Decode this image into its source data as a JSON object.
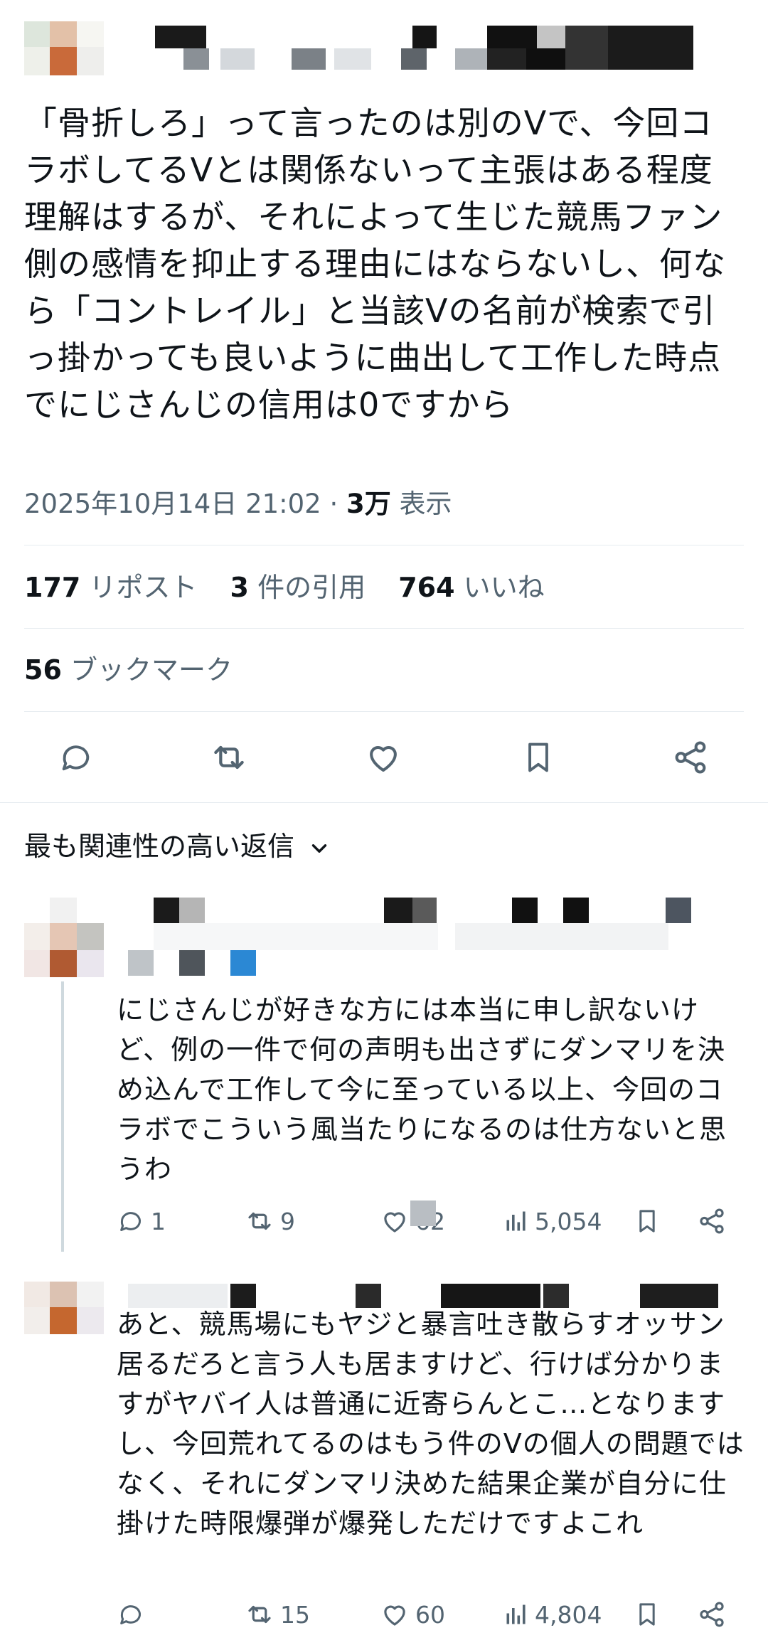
{
  "tweet": {
    "text": "「骨折しろ」って言ったのは別のVで、今回コラボしてるVとは関係ないって主張はある程度理解はするが、それによって生じた競馬ファン側の感情を抑止する理由にはならないし、何なら「コントレイル」と当該Vの名前が検索で引っ掛かっても良いように曲出して工作した時点でにじさんじの信用は0ですから",
    "timestamp": "2025年10月14日 21:02",
    "separator": "·",
    "views_count": "3万",
    "views_label": "表示"
  },
  "stats": {
    "reposts_count": "177",
    "reposts_label": "リポスト",
    "quotes_count": "3",
    "quotes_label": "件の引用",
    "likes_count": "764",
    "likes_label": "いいね",
    "bookmarks_count": "56",
    "bookmarks_label": "ブックマーク"
  },
  "actions": {
    "icons": [
      "reply-icon",
      "retweet-icon",
      "like-icon",
      "bookmark-icon",
      "share-icon"
    ]
  },
  "replies_section": {
    "sort_label": "最も関連性の高い返信"
  },
  "replies": [
    {
      "text": "にじさんじが好きな方には本当に申し訳ないけど、例の一件で何の声明も出さずにダンマリを決め込んで工作して今に至っている以上、今回のコラボでこういう風当たりになるのは仕方ないと思うわ",
      "reply_count": "1",
      "retweet_count": "9",
      "like_count": "62",
      "views": "5,054"
    },
    {
      "text": "あと、競馬場にもヤジと暴言吐き散らすオッサン居るだろと言う人も居ますけど、行けば分かりますがヤバイ人は普通に近寄らんとこ…となりますし、今回荒れてるのはもう件のVの個人の問題ではなく、それにダンマリ決めた結果企業が自分に仕掛けた時限爆弾が爆発しただけですよこれ",
      "reply_count": "",
      "retweet_count": "15",
      "like_count": "60",
      "views": "4,804"
    }
  ],
  "colors": {
    "text": "#0f1419",
    "secondary": "#536471",
    "divider": "#e6ecf0",
    "accent": "#1d9bf0"
  }
}
